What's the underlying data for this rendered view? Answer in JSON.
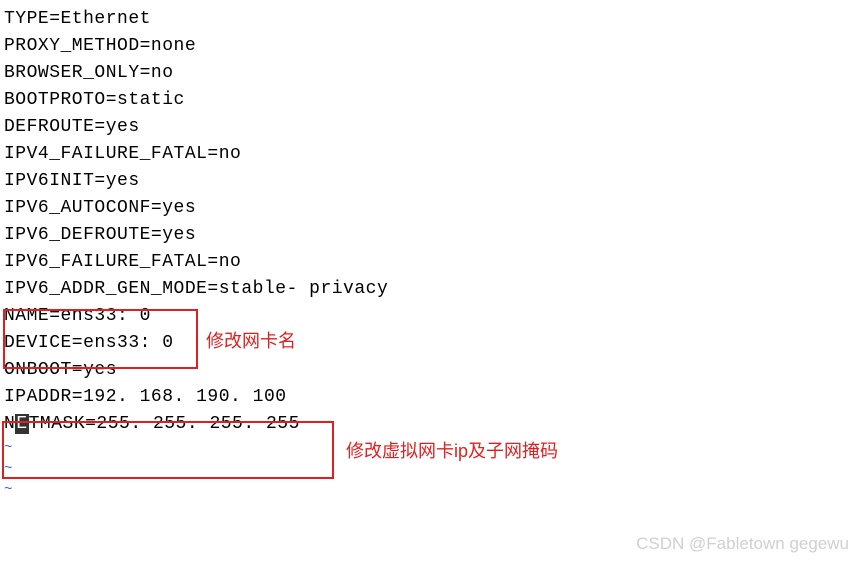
{
  "config": {
    "lines": [
      "TYPE=Ethernet",
      "PROXY_METHOD=none",
      "BROWSER_ONLY=no",
      "BOOTPROTO=static",
      "DEFROUTE=yes",
      "IPV4_FAILURE_FATAL=no",
      "IPV6INIT=yes",
      "IPV6_AUTOCONF=yes",
      "IPV6_DEFROUTE=yes",
      "IPV6_FAILURE_FATAL=no",
      "IPV6_ADDR_GEN_MODE=stable- privacy",
      "NAME=ens33: 0",
      "DEVICE=ens33: 0",
      "ONBOOT=yes",
      "IPADDR=192. 168. 190. 100"
    ],
    "cursor_line": {
      "prefix": "N",
      "cursor": "E",
      "suffix": "TMASK=255. 255. 255. 255"
    },
    "tilde": "~"
  },
  "annotations": {
    "box1_label": "修改网卡名",
    "box2_label": "修改虚拟网卡ip及子网掩码"
  },
  "watermark": "CSDN @Fabletown gegewu"
}
